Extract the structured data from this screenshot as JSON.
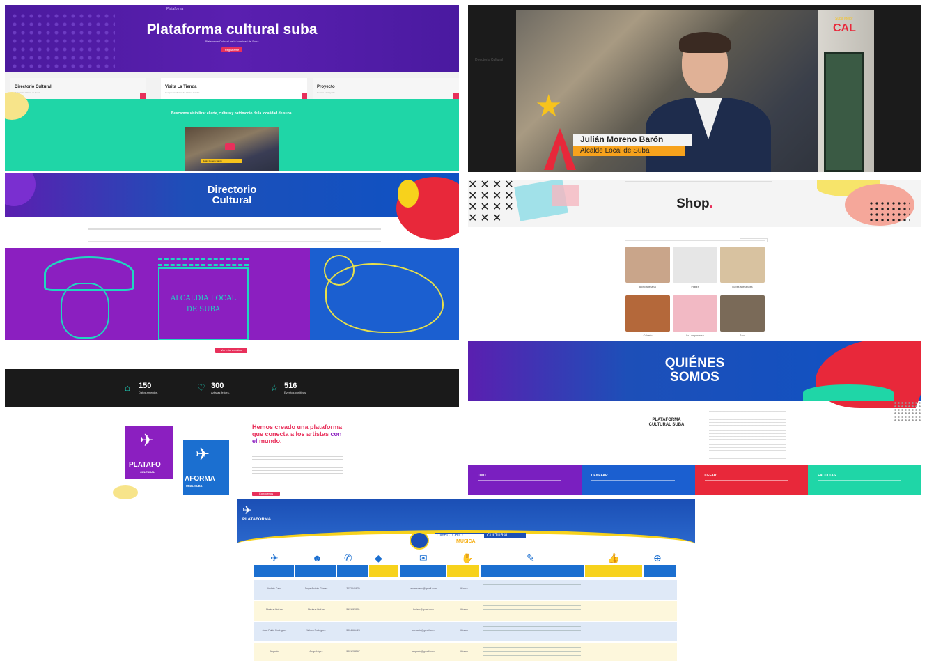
{
  "panel_home": {
    "logo": "Plataforma",
    "title": "Plataforma cultural suba",
    "subtitle": "Plataforma Cultural de la localidad de Suba",
    "cta": "Registrarse",
    "cards": [
      {
        "title": "Directorio Cultural",
        "sub": "Encuentra artistas de Suba"
      },
      {
        "title": "Visita La Tienda",
        "sub": "Compra productos de artistas locales"
      },
      {
        "title": "Proyecto",
        "sub": "Conoce el proyecto"
      }
    ],
    "mission": "Buscamos visibilizar el arte, cultura y patrimonio de la localidad de suba.",
    "thumb_caption": "Julián Moreno Barón"
  },
  "panel_video": {
    "side_text": "Directorio Cultural",
    "name": "Julián Moreno Barón",
    "role": "Alcalde Local de Suba",
    "brand_top": "Suba Mejor",
    "brand": "CAL"
  },
  "panel_directorio": {
    "title_line1": "Directorio",
    "title_line2": "Cultural",
    "building_text_1": "ALCALDIA LOCAL",
    "building_text_2": "DE SUBA",
    "cta": "Ver directorio"
  },
  "panel_shop": {
    "title": "Shop",
    "products": [
      {
        "label": "Bolso artesanal",
        "color": "#c9a58a"
      },
      {
        "label": "Pintura",
        "color": "#e6e6e6"
      },
      {
        "label": "Llaves artesanales",
        "color": "#d8c2a0"
      },
      {
        "label": "Calzado",
        "color": "#b4683a"
      },
      {
        "label": "Lo Lumpen rosa",
        "color": "#f2b9c4"
      },
      {
        "label": "Saco",
        "color": "#7a6a58"
      }
    ]
  },
  "panel_stats": {
    "cta": "Ver más eventos",
    "stats": [
      {
        "icon": "inbox-icon",
        "num": "150",
        "label": "Datos amentos."
      },
      {
        "icon": "heart-icon",
        "num": "300",
        "label": "Artistas felices."
      },
      {
        "icon": "star-icon",
        "num": "516",
        "label": "Eventos positivas."
      }
    ],
    "logo_text_1": "PLATAFO",
    "logo_sub_1": "CULTURAL",
    "logo_text_2": "AFORMA",
    "logo_sub_2": "URAL SUBA",
    "headline_pre": "Hemos creado una plataforma que conecta a los artistas",
    "headline_mid": " con el",
    "headline_post": " mundo.",
    "cta2": "Conócenos"
  },
  "panel_about": {
    "title_line1": "QUIÉNES",
    "title_line2": "SOMOS",
    "plat_line1": "PLATAFORMA",
    "plat_line2": "CULTURAL SUBA",
    "bands": [
      {
        "label": "OMD",
        "color": "#7a1fc0"
      },
      {
        "label": "CENEFAR",
        "color": "#1b5fd0"
      },
      {
        "label": "CEFAR",
        "color": "#e8283a"
      },
      {
        "label": "FACULTAS",
        "color": "#1fd6a7"
      }
    ]
  },
  "panel_table": {
    "logo_text": "PLATAFORMA",
    "dir_1": "DIRECTORIO",
    "dir_2": "CULTURAL",
    "dir_3": "MÚSICA",
    "rows": [
      {
        "name": "Andrés Cano",
        "contact": "Jorge Andrés Gómez",
        "phone": "3112345670",
        "mail": "andrescano@gmail.com",
        "genre": "Música"
      },
      {
        "name": "Mariana Bolívar",
        "contact": "Mariana Bolívar",
        "phone": "3191020131",
        "mail": "bolivar@gmail.com",
        "genre": "Música"
      },
      {
        "name": "Juan Pablo Rodríguez",
        "contact": "Wilson Rodríguez",
        "phone": "3004561423",
        "mail": "contacto@gmail.com",
        "genre": "Música"
      },
      {
        "name": "Augusto",
        "contact": "Jorge López",
        "phone": "3001234567",
        "mail": "augusto@gmail.com",
        "genre": "Música"
      }
    ]
  }
}
